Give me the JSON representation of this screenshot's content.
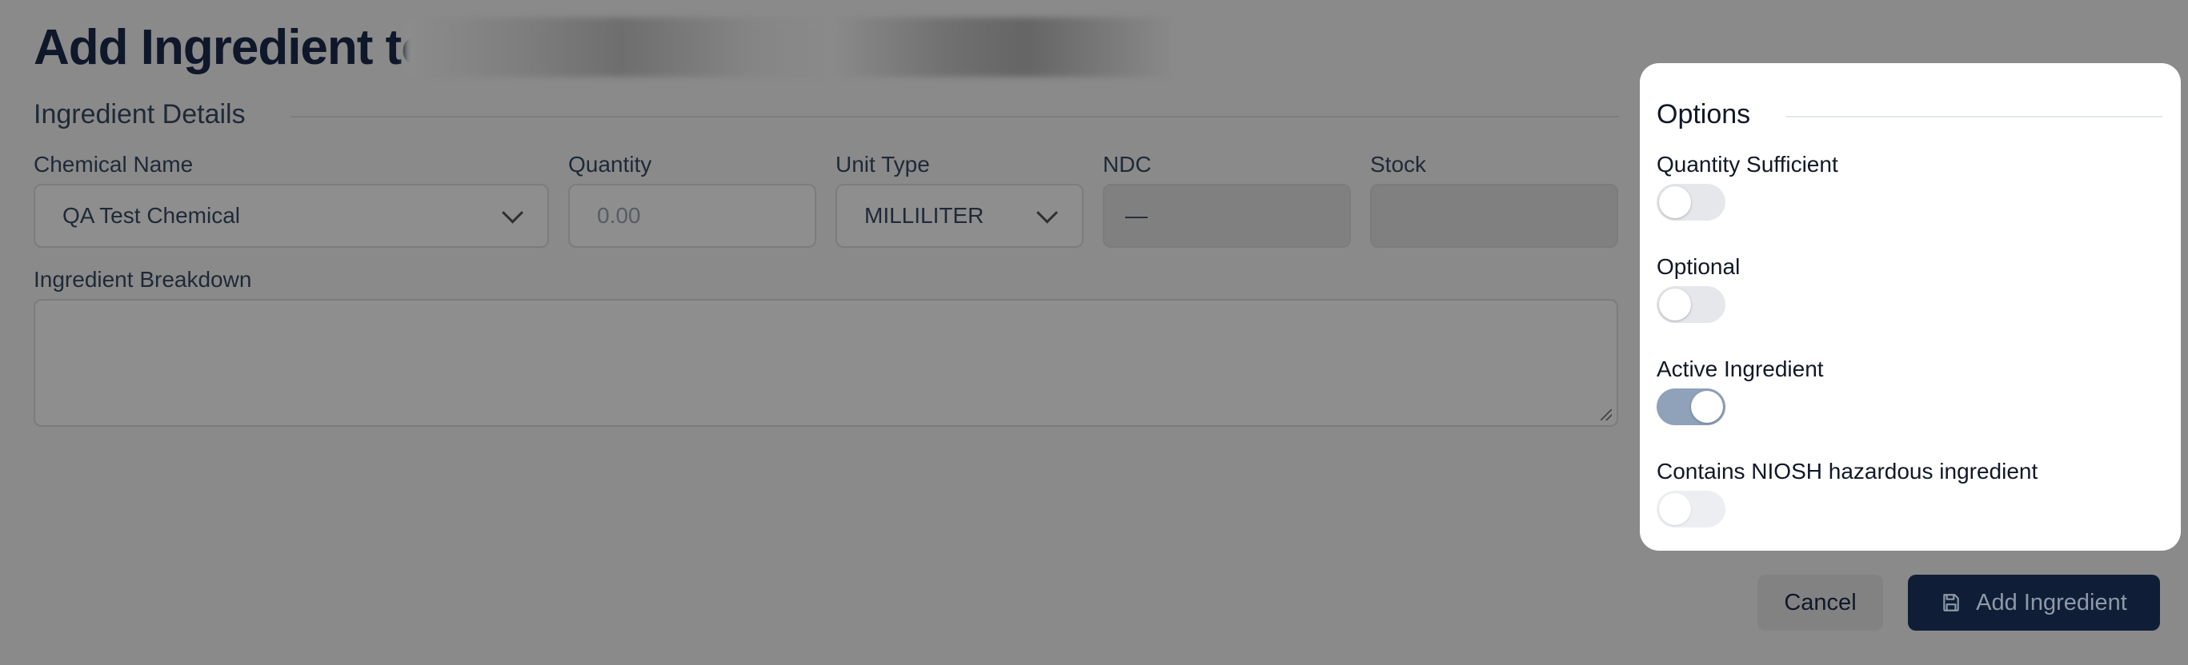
{
  "page": {
    "title": "Add Ingredient to"
  },
  "ingredient_details": {
    "section_title": "Ingredient Details",
    "chemical_name": {
      "label": "Chemical Name",
      "value": "QA Test Chemical"
    },
    "quantity": {
      "label": "Quantity",
      "placeholder": "0.00"
    },
    "unit_type": {
      "label": "Unit Type",
      "value": "MILLILITER"
    },
    "ndc": {
      "label": "NDC",
      "value": "—"
    },
    "stock": {
      "label": "Stock",
      "value": ""
    },
    "breakdown": {
      "label": "Ingredient Breakdown",
      "value": ""
    }
  },
  "options": {
    "section_title": "Options",
    "items": [
      {
        "label": "Quantity Sufficient",
        "checked": false
      },
      {
        "label": "Optional",
        "checked": false
      },
      {
        "label": "Active Ingredient",
        "checked": true
      },
      {
        "label": "Contains NIOSH hazardous ingredient",
        "checked": false
      }
    ]
  },
  "actions": {
    "cancel_label": "Cancel",
    "add_label": "Add Ingredient"
  },
  "colors": {
    "overlay": "#8a8a8a",
    "primary": "#0f1e36",
    "toggle_on": "#8fa2b9",
    "toggle_off": "#e5e7eb"
  }
}
